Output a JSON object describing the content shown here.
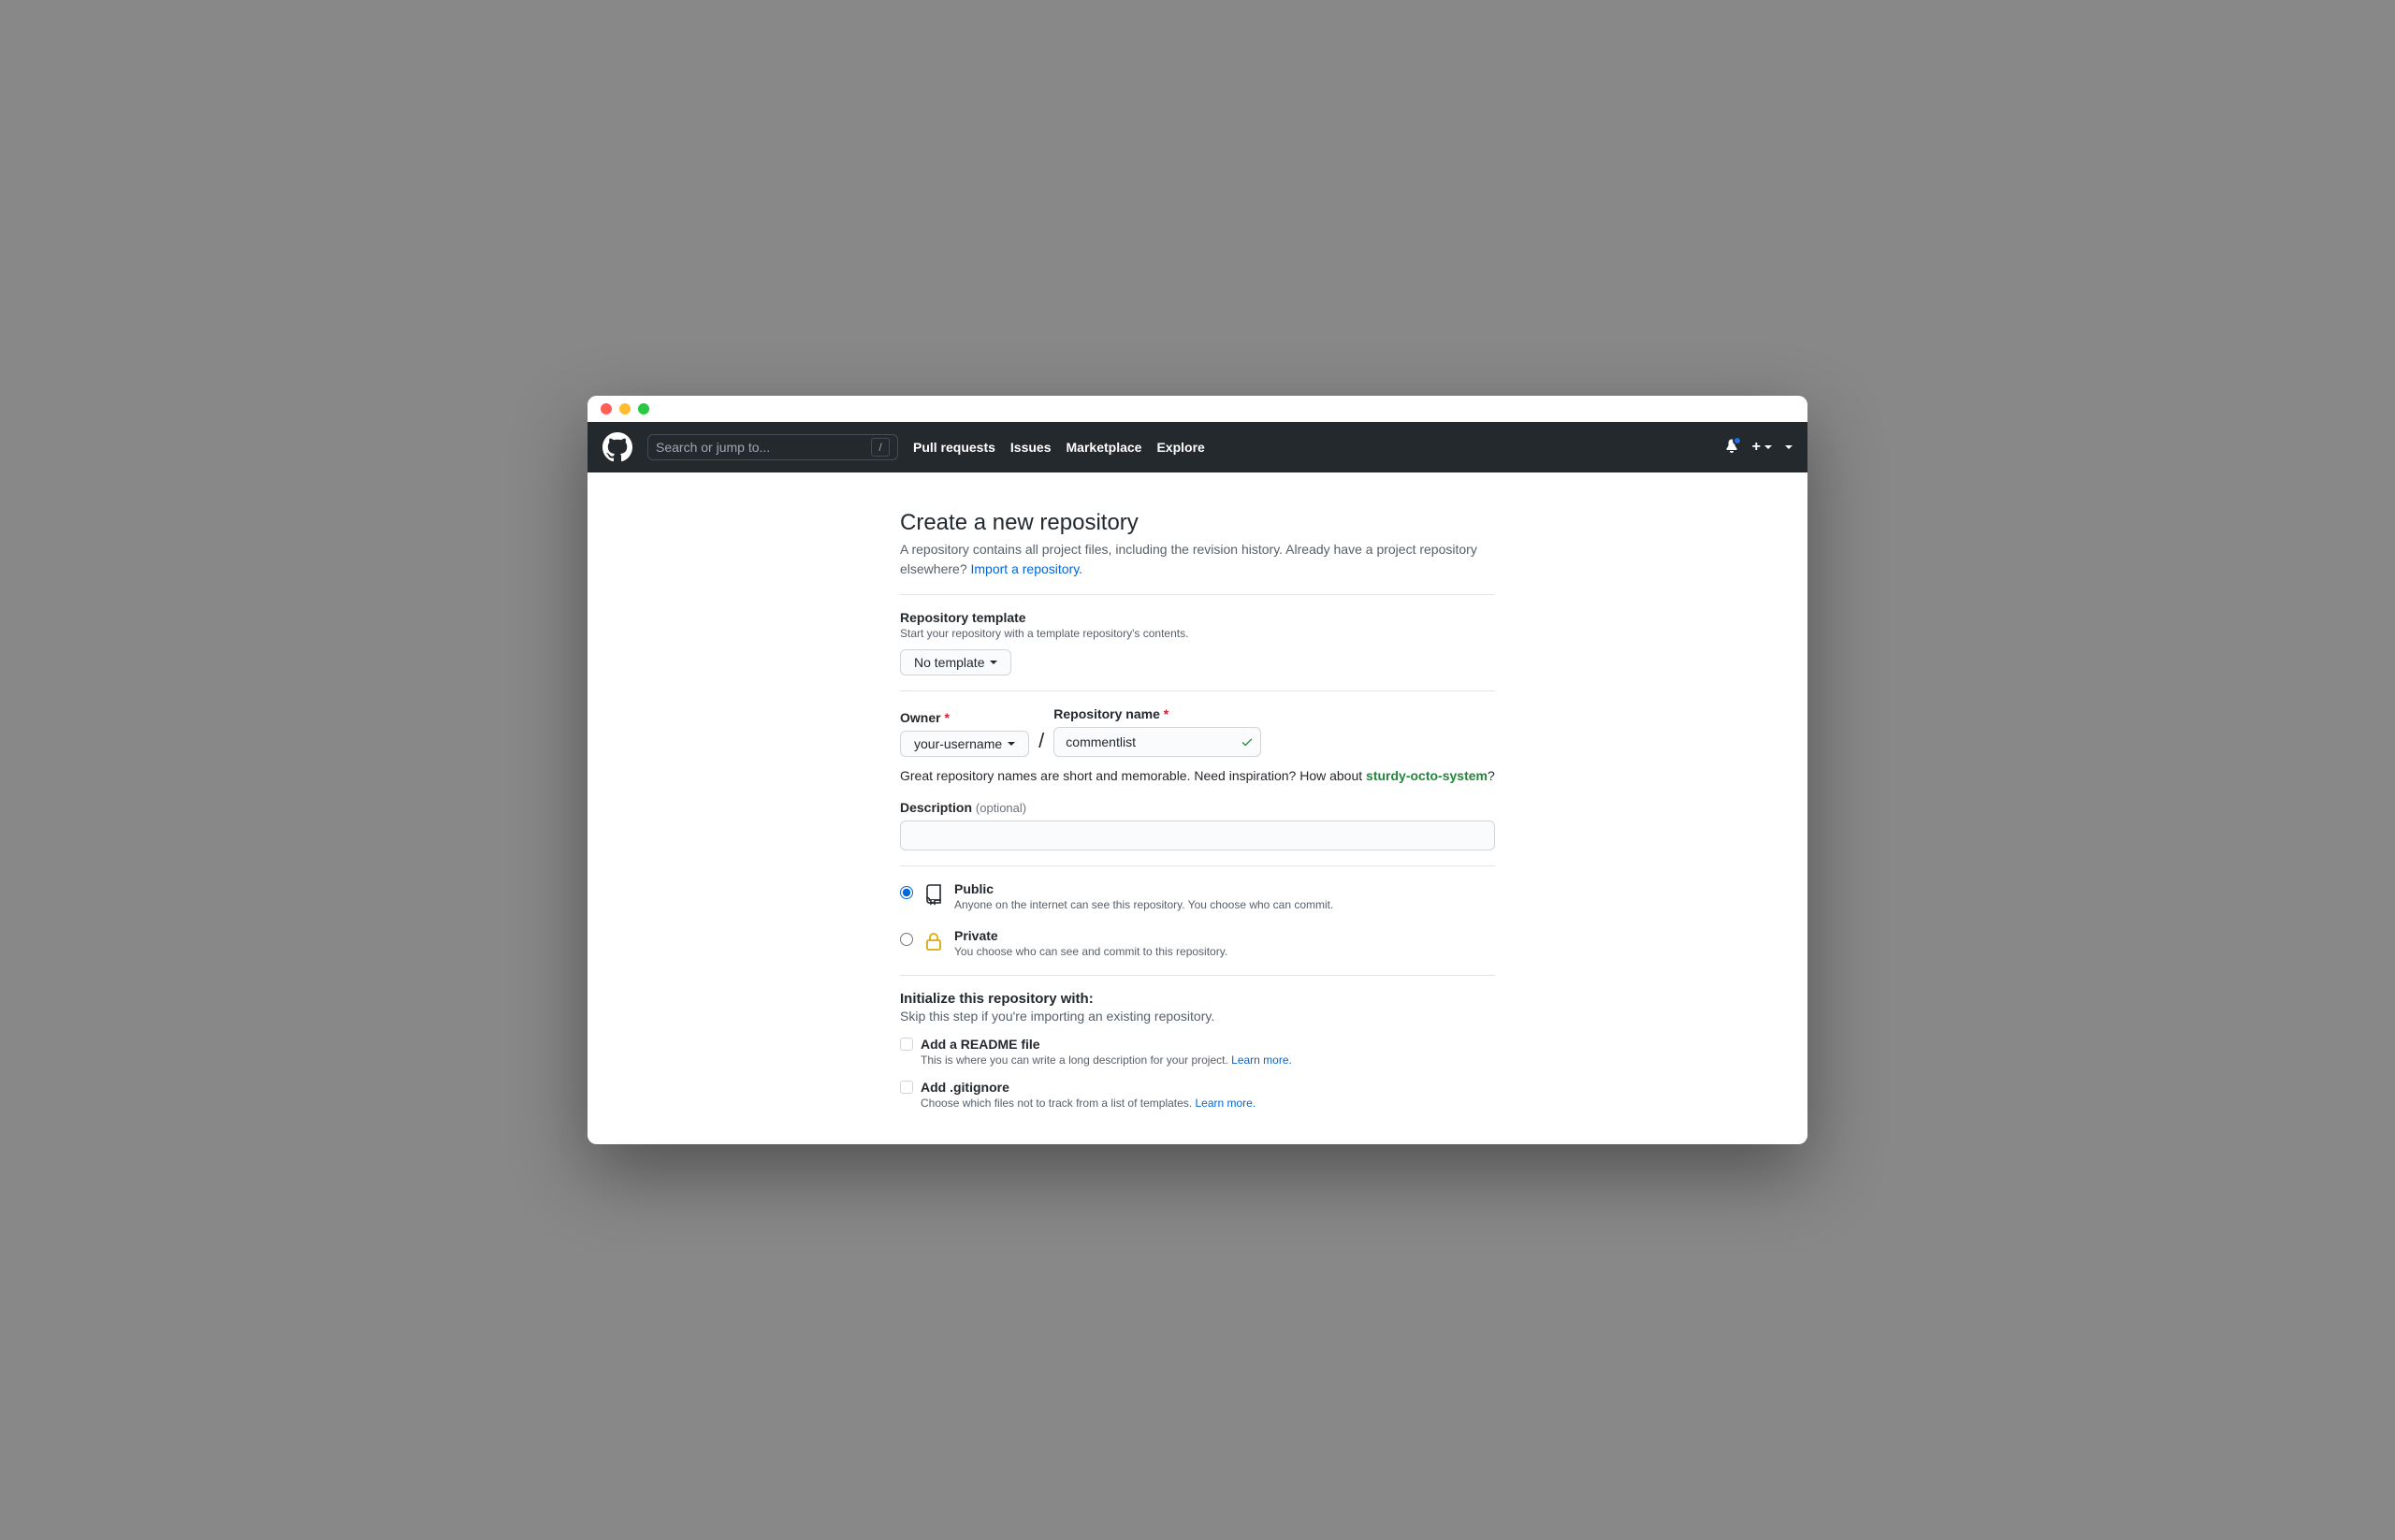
{
  "header": {
    "search_placeholder": "Search or jump to...",
    "slash_key": "/",
    "nav": [
      "Pull requests",
      "Issues",
      "Marketplace",
      "Explore"
    ],
    "plus_label": "+"
  },
  "page": {
    "title": "Create a new repository",
    "intro_a": "A repository contains all project files, including the revision history. Already have a project repository elsewhere? ",
    "intro_link": "Import a repository."
  },
  "template": {
    "label": "Repository template",
    "hint": "Start your repository with a template repository's contents.",
    "selected": "No template"
  },
  "owner": {
    "label": "Owner",
    "value": "your-username"
  },
  "repo": {
    "label": "Repository name",
    "value": "commentlist"
  },
  "name_hint": {
    "pre": "Great repository names are short and memorable. Need inspiration? How about ",
    "suggestion": "sturdy-octo-system",
    "post": "?"
  },
  "description": {
    "label": "Description",
    "optional": "(optional)",
    "value": ""
  },
  "visibility": {
    "public": {
      "title": "Public",
      "desc": "Anyone on the internet can see this repository. You choose who can commit."
    },
    "private": {
      "title": "Private",
      "desc": "You choose who can see and commit to this repository."
    }
  },
  "init": {
    "heading": "Initialize this repository with:",
    "hint": "Skip this step if you're importing an existing repository.",
    "readme": {
      "title": "Add a README file",
      "desc": "This is where you can write a long description for your project. ",
      "learn": "Learn more."
    },
    "gitignore": {
      "title": "Add .gitignore",
      "desc": "Choose which files not to track from a list of templates. ",
      "learn": "Learn more."
    }
  }
}
